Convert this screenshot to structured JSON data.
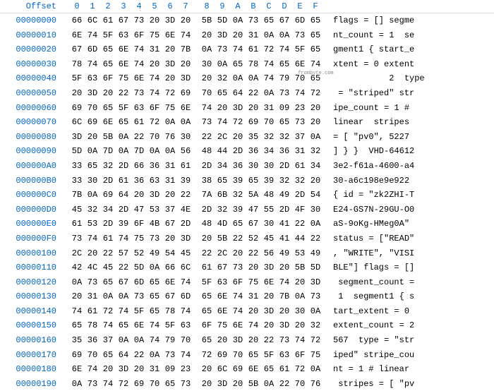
{
  "header": {
    "offset_label": "Offset",
    "columns": [
      "0",
      "1",
      "2",
      "3",
      "4",
      "5",
      "6",
      "7",
      "8",
      "9",
      "A",
      "B",
      "C",
      "D",
      "E",
      "F"
    ]
  },
  "watermark": "_frombyte.com",
  "rows": [
    {
      "offset": "00000000",
      "hex": [
        "66",
        "6C",
        "61",
        "67",
        "73",
        "20",
        "3D",
        "20",
        "5B",
        "5D",
        "0A",
        "73",
        "65",
        "67",
        "6D",
        "65"
      ],
      "ascii": "flags = [] segme"
    },
    {
      "offset": "00000010",
      "hex": [
        "6E",
        "74",
        "5F",
        "63",
        "6F",
        "75",
        "6E",
        "74",
        "20",
        "3D",
        "20",
        "31",
        "0A",
        "0A",
        "73",
        "65"
      ],
      "ascii": "nt_count = 1  se"
    },
    {
      "offset": "00000020",
      "hex": [
        "67",
        "6D",
        "65",
        "6E",
        "74",
        "31",
        "20",
        "7B",
        "0A",
        "73",
        "74",
        "61",
        "72",
        "74",
        "5F",
        "65"
      ],
      "ascii": "gment1 { start_e"
    },
    {
      "offset": "00000030",
      "hex": [
        "78",
        "74",
        "65",
        "6E",
        "74",
        "20",
        "3D",
        "20",
        "30",
        "0A",
        "65",
        "78",
        "74",
        "65",
        "6E",
        "74"
      ],
      "ascii": "xtent = 0 extent"
    },
    {
      "offset": "00000040",
      "hex": [
        "5F",
        "63",
        "6F",
        "75",
        "6E",
        "74",
        "20",
        "3D",
        "20",
        "32",
        "0A",
        "0A",
        "74",
        "79",
        "70",
        "65"
      ],
      "ascii": "           2  type"
    },
    {
      "offset": "00000050",
      "hex": [
        "20",
        "3D",
        "20",
        "22",
        "73",
        "74",
        "72",
        "69",
        "70",
        "65",
        "64",
        "22",
        "0A",
        "73",
        "74",
        "72"
      ],
      "ascii": " = \"striped\" str"
    },
    {
      "offset": "00000060",
      "hex": [
        "69",
        "70",
        "65",
        "5F",
        "63",
        "6F",
        "75",
        "6E",
        "74",
        "20",
        "3D",
        "20",
        "31",
        "09",
        "23",
        "20"
      ],
      "ascii": "ipe_count = 1 # "
    },
    {
      "offset": "00000070",
      "hex": [
        "6C",
        "69",
        "6E",
        "65",
        "61",
        "72",
        "0A",
        "0A",
        "73",
        "74",
        "72",
        "69",
        "70",
        "65",
        "73",
        "20"
      ],
      "ascii": "linear  stripes "
    },
    {
      "offset": "00000080",
      "hex": [
        "3D",
        "20",
        "5B",
        "0A",
        "22",
        "70",
        "76",
        "30",
        "22",
        "2C",
        "20",
        "35",
        "32",
        "32",
        "37",
        "0A"
      ],
      "ascii": "= [ \"pv0\", 5227 "
    },
    {
      "offset": "00000090",
      "hex": [
        "5D",
        "0A",
        "7D",
        "0A",
        "7D",
        "0A",
        "0A",
        "56",
        "48",
        "44",
        "2D",
        "36",
        "34",
        "36",
        "31",
        "32"
      ],
      "ascii": "] } }  VHD-64612"
    },
    {
      "offset": "000000A0",
      "hex": [
        "33",
        "65",
        "32",
        "2D",
        "66",
        "36",
        "31",
        "61",
        "2D",
        "34",
        "36",
        "30",
        "30",
        "2D",
        "61",
        "34"
      ],
      "ascii": "3e2-f61a-4600-a4"
    },
    {
      "offset": "000000B0",
      "hex": [
        "33",
        "30",
        "2D",
        "61",
        "36",
        "63",
        "31",
        "39",
        "38",
        "65",
        "39",
        "65",
        "39",
        "32",
        "32",
        "20"
      ],
      "ascii": "30-a6c198e9e922 "
    },
    {
      "offset": "000000C0",
      "hex": [
        "7B",
        "0A",
        "69",
        "64",
        "20",
        "3D",
        "20",
        "22",
        "7A",
        "6B",
        "32",
        "5A",
        "48",
        "49",
        "2D",
        "54"
      ],
      "ascii": "{ id = \"zk2ZHI-T"
    },
    {
      "offset": "000000D0",
      "hex": [
        "45",
        "32",
        "34",
        "2D",
        "47",
        "53",
        "37",
        "4E",
        "2D",
        "32",
        "39",
        "47",
        "55",
        "2D",
        "4F",
        "30"
      ],
      "ascii": "E24-GS7N-29GU-O0"
    },
    {
      "offset": "000000E0",
      "hex": [
        "61",
        "53",
        "2D",
        "39",
        "6F",
        "4B",
        "67",
        "2D",
        "48",
        "4D",
        "65",
        "67",
        "30",
        "41",
        "22",
        "0A"
      ],
      "ascii": "aS-9oKg-HMeg0A\" "
    },
    {
      "offset": "000000F0",
      "hex": [
        "73",
        "74",
        "61",
        "74",
        "75",
        "73",
        "20",
        "3D",
        "20",
        "5B",
        "22",
        "52",
        "45",
        "41",
        "44",
        "22"
      ],
      "ascii": "status = [\"READ\""
    },
    {
      "offset": "00000100",
      "hex": [
        "2C",
        "20",
        "22",
        "57",
        "52",
        "49",
        "54",
        "45",
        "22",
        "2C",
        "20",
        "22",
        "56",
        "49",
        "53",
        "49"
      ],
      "ascii": ", \"WRITE\", \"VISI"
    },
    {
      "offset": "00000110",
      "hex": [
        "42",
        "4C",
        "45",
        "22",
        "5D",
        "0A",
        "66",
        "6C",
        "61",
        "67",
        "73",
        "20",
        "3D",
        "20",
        "5B",
        "5D"
      ],
      "ascii": "BLE\"] flags = []"
    },
    {
      "offset": "00000120",
      "hex": [
        "0A",
        "73",
        "65",
        "67",
        "6D",
        "65",
        "6E",
        "74",
        "5F",
        "63",
        "6F",
        "75",
        "6E",
        "74",
        "20",
        "3D"
      ],
      "ascii": " segment_count ="
    },
    {
      "offset": "00000130",
      "hex": [
        "20",
        "31",
        "0A",
        "0A",
        "73",
        "65",
        "67",
        "6D",
        "65",
        "6E",
        "74",
        "31",
        "20",
        "7B",
        "0A",
        "73"
      ],
      "ascii": " 1  segment1 { s"
    },
    {
      "offset": "00000140",
      "hex": [
        "74",
        "61",
        "72",
        "74",
        "5F",
        "65",
        "78",
        "74",
        "65",
        "6E",
        "74",
        "20",
        "3D",
        "20",
        "30",
        "0A"
      ],
      "ascii": "tart_extent = 0 "
    },
    {
      "offset": "00000150",
      "hex": [
        "65",
        "78",
        "74",
        "65",
        "6E",
        "74",
        "5F",
        "63",
        "6F",
        "75",
        "6E",
        "74",
        "20",
        "3D",
        "20",
        "32"
      ],
      "ascii": "extent_count = 2"
    },
    {
      "offset": "00000160",
      "hex": [
        "35",
        "36",
        "37",
        "0A",
        "0A",
        "74",
        "79",
        "70",
        "65",
        "20",
        "3D",
        "20",
        "22",
        "73",
        "74",
        "72"
      ],
      "ascii": "567  type = \"str"
    },
    {
      "offset": "00000170",
      "hex": [
        "69",
        "70",
        "65",
        "64",
        "22",
        "0A",
        "73",
        "74",
        "72",
        "69",
        "70",
        "65",
        "5F",
        "63",
        "6F",
        "75"
      ],
      "ascii": "iped\" stripe_cou"
    },
    {
      "offset": "00000180",
      "hex": [
        "6E",
        "74",
        "20",
        "3D",
        "20",
        "31",
        "09",
        "23",
        "20",
        "6C",
        "69",
        "6E",
        "65",
        "61",
        "72",
        "0A"
      ],
      "ascii": "nt = 1 # linear "
    },
    {
      "offset": "00000190",
      "hex": [
        "0A",
        "73",
        "74",
        "72",
        "69",
        "70",
        "65",
        "73",
        "20",
        "3D",
        "20",
        "5B",
        "0A",
        "22",
        "70",
        "76"
      ],
      "ascii": " stripes = [ \"pv"
    }
  ]
}
